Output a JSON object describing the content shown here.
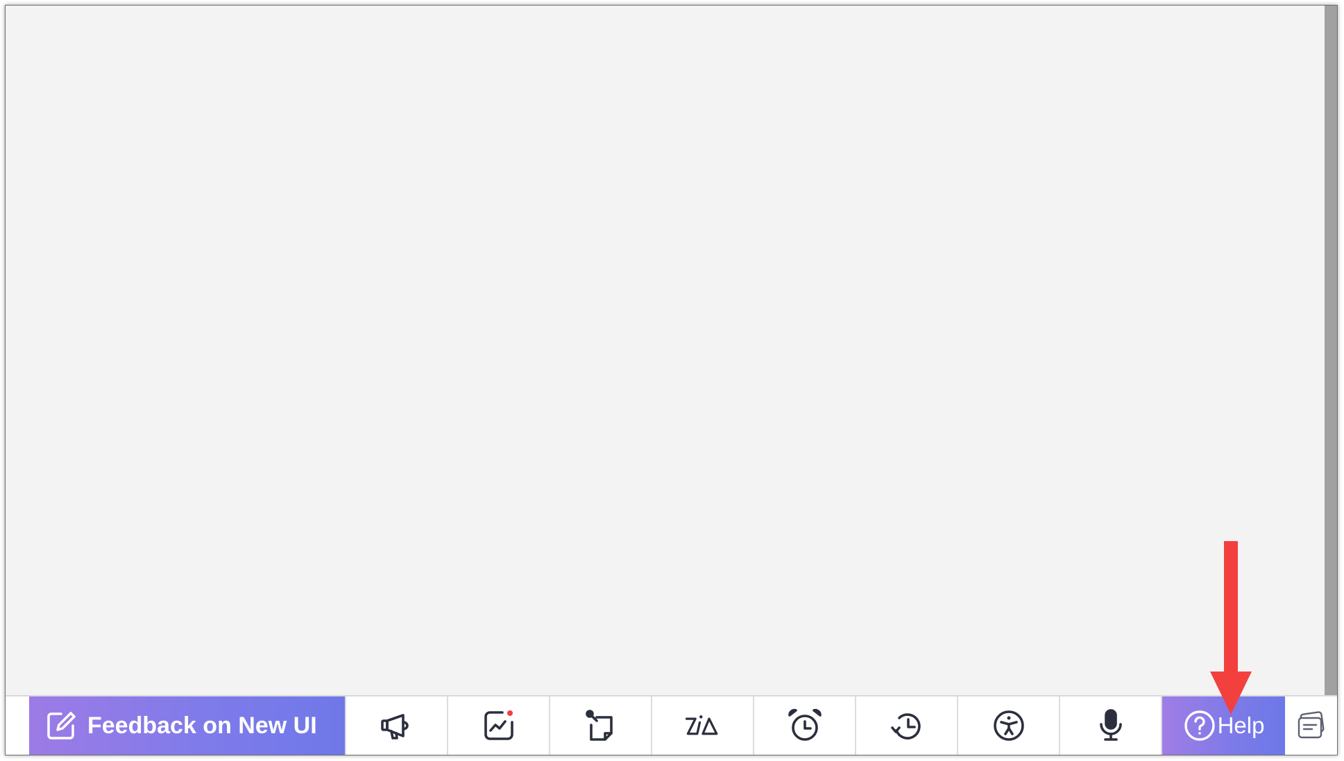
{
  "toolbar": {
    "feedback": {
      "label": "Feedback on New UI",
      "icon": "edit-icon"
    },
    "tools": [
      {
        "icon": "megaphone-icon"
      },
      {
        "icon": "chart-notification-icon"
      },
      {
        "icon": "sticky-note-icon"
      },
      {
        "icon": "zia-icon"
      },
      {
        "icon": "alarm-clock-icon"
      },
      {
        "icon": "history-icon"
      },
      {
        "icon": "accessibility-icon"
      },
      {
        "icon": "microphone-icon"
      }
    ],
    "help": {
      "label": "Help",
      "icon": "help-circle-icon"
    },
    "notes": {
      "icon": "notes-icon"
    }
  },
  "annotation": {
    "type": "arrow",
    "color": "#f2403f",
    "points_to": "help-button"
  },
  "colors": {
    "accent_gradient_start": "#9d7be6",
    "accent_gradient_end": "#6f78e8",
    "icon_stroke": "#2b2f3d",
    "background": "#f3f3f3"
  }
}
